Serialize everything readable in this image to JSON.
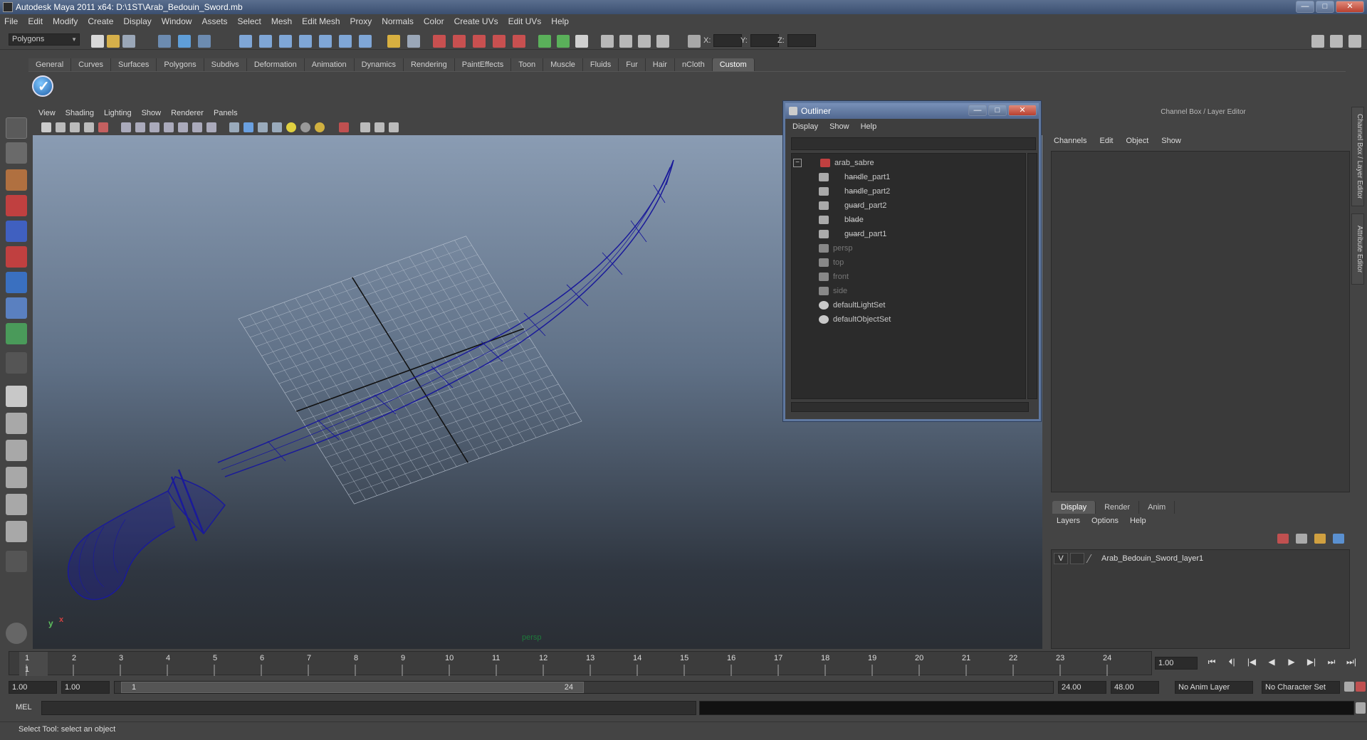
{
  "window": {
    "title": "Autodesk Maya 2011 x64: D:\\1ST\\Arab_Bedouin_Sword.mb",
    "min": "—",
    "max": "□",
    "close": "✕"
  },
  "menubar": [
    "File",
    "Edit",
    "Modify",
    "Create",
    "Display",
    "Window",
    "Assets",
    "Select",
    "Mesh",
    "Edit Mesh",
    "Proxy",
    "Normals",
    "Color",
    "Create UVs",
    "Edit UVs",
    "Help"
  ],
  "statusline": {
    "mode": "Polygons",
    "x_label": "X:",
    "y_label": "Y:",
    "z_label": "Z:"
  },
  "shelf": {
    "tabs": [
      "General",
      "Curves",
      "Surfaces",
      "Polygons",
      "Subdivs",
      "Deformation",
      "Animation",
      "Dynamics",
      "Rendering",
      "PaintEffects",
      "Toon",
      "Muscle",
      "Fluids",
      "Fur",
      "Hair",
      "nCloth",
      "Custom"
    ],
    "active": "Custom"
  },
  "viewport": {
    "menu": [
      "View",
      "Shading",
      "Lighting",
      "Show",
      "Renderer",
      "Panels"
    ],
    "camera_label": "persp",
    "axis_y": "y",
    "axis_x": "x"
  },
  "outliner": {
    "title": "Outliner",
    "menu": [
      "Display",
      "Show",
      "Help"
    ],
    "items": [
      {
        "label": "arab_sabre",
        "indent": 0,
        "dim": false,
        "collapse": "−"
      },
      {
        "label": "handle_part1",
        "indent": 1,
        "dim": false
      },
      {
        "label": "handle_part2",
        "indent": 1,
        "dim": false
      },
      {
        "label": "guard_part2",
        "indent": 1,
        "dim": false
      },
      {
        "label": "blade",
        "indent": 1,
        "dim": false
      },
      {
        "label": "guard_part1",
        "indent": 1,
        "dim": false
      },
      {
        "label": "persp",
        "indent": 0,
        "dim": true
      },
      {
        "label": "top",
        "indent": 0,
        "dim": true
      },
      {
        "label": "front",
        "indent": 0,
        "dim": true
      },
      {
        "label": "side",
        "indent": 0,
        "dim": true
      },
      {
        "label": "defaultLightSet",
        "indent": 0,
        "dim": false
      },
      {
        "label": "defaultObjectSet",
        "indent": 0,
        "dim": false
      }
    ]
  },
  "channelbox": {
    "title": "Channel Box / Layer Editor",
    "menu": [
      "Channels",
      "Edit",
      "Object",
      "Show"
    ],
    "side_tabs": [
      "Channel Box / Layer Editor",
      "Attribute Editor"
    ]
  },
  "layers": {
    "tabs": [
      "Display",
      "Render",
      "Anim"
    ],
    "active": "Display",
    "menu": [
      "Layers",
      "Options",
      "Help"
    ],
    "rows": [
      {
        "visible": "V",
        "name": "Arab_Bedouin_Sword_layer1"
      }
    ]
  },
  "timeline": {
    "ticks": [
      "1",
      "2",
      "3",
      "4",
      "5",
      "6",
      "7",
      "8",
      "9",
      "10",
      "11",
      "12",
      "13",
      "14",
      "15",
      "16",
      "17",
      "18",
      "19",
      "20",
      "21",
      "22",
      "23",
      "24"
    ],
    "current_frame_marker": "1",
    "current_frame": "1.00",
    "controls": [
      "⏮",
      "⏴|",
      "|◀",
      "◀",
      "▶",
      "▶|",
      "⏭",
      "⏭|"
    ]
  },
  "range": {
    "start": "1.00",
    "playback_start": "1.00",
    "handle_start": "1",
    "handle_end": "24",
    "playback_end": "24.00",
    "end": "48.00",
    "anim_layer": "No Anim Layer",
    "char_set": "No Character Set"
  },
  "command": {
    "label": "MEL"
  },
  "help_line": "Select Tool: select an object",
  "colors": {
    "accent": "#5f78a0",
    "wire": "#1a1a9a",
    "viewport_top": "#8a9cb3",
    "viewport_bottom": "#2a2e34"
  }
}
